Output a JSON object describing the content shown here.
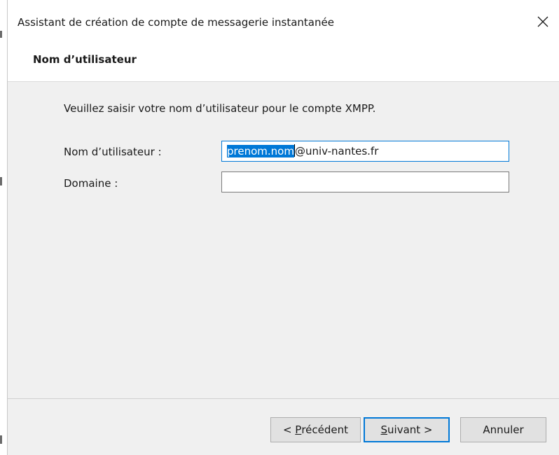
{
  "window": {
    "title": "Assistant de création de compte de messagerie instantanée",
    "close_icon": "close-icon"
  },
  "header": {
    "title": "Nom d’utilisateur"
  },
  "main": {
    "instruction": "Veuillez saisir votre nom d’utilisateur pour le compte XMPP.",
    "username": {
      "label": "Nom d’utilisateur :",
      "selected_text": "prenom.nom",
      "rest_text": "@univ-nantes.fr"
    },
    "domain": {
      "label": "Domaine :",
      "value": ""
    }
  },
  "footer": {
    "back": {
      "accel": "P",
      "rest": "récédent",
      "prefix": "< "
    },
    "next": {
      "accel": "S",
      "rest": "uivant >"
    },
    "cancel": {
      "label": "Annuler"
    }
  },
  "colors": {
    "accent": "#0078d7",
    "dialog_bg": "#f0f0f0",
    "header_bg": "#ffffff"
  }
}
